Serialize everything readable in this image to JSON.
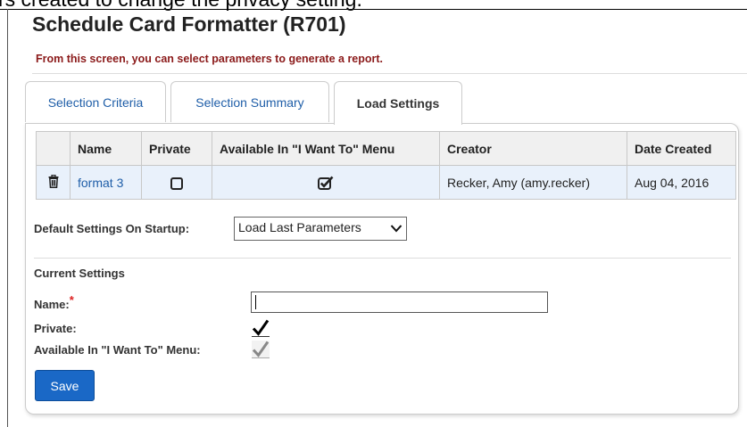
{
  "clipped_header_text": "rs created to change the privacy setting.",
  "page": {
    "title": "Schedule Card Formatter (R701)",
    "subtitle": "From this screen, you can select parameters to generate a report."
  },
  "tabs": [
    {
      "label": "Selection Criteria",
      "active": false
    },
    {
      "label": "Selection Summary",
      "active": false
    },
    {
      "label": "Load Settings",
      "active": true
    }
  ],
  "table": {
    "headers": [
      "",
      "Name",
      "Private",
      "Available In \"I Want To\" Menu",
      "Creator",
      "Date Created"
    ],
    "rows": [
      {
        "icon": "trash-icon",
        "name": "format 3",
        "private": false,
        "available": true,
        "creator": "Recker, Amy (amy.recker)",
        "date_created": "Aug 04, 2016"
      }
    ]
  },
  "default_settings": {
    "label": "Default Settings On Startup:",
    "selected": "Load Last Parameters"
  },
  "current_settings": {
    "heading": "Current Settings",
    "name_label": "Name:",
    "required_mark": "*",
    "name_value": "",
    "private_label": "Private:",
    "private_checked": true,
    "available_label": "Available In \"I Want To\" Menu:",
    "available_checked": true,
    "available_disabled": true
  },
  "save_label": "Save",
  "colors": {
    "link": "#1f5ea8",
    "subtitle": "#8b1a1a",
    "save_button": "#1a68c6",
    "selected_row": "#e9f1fb"
  }
}
